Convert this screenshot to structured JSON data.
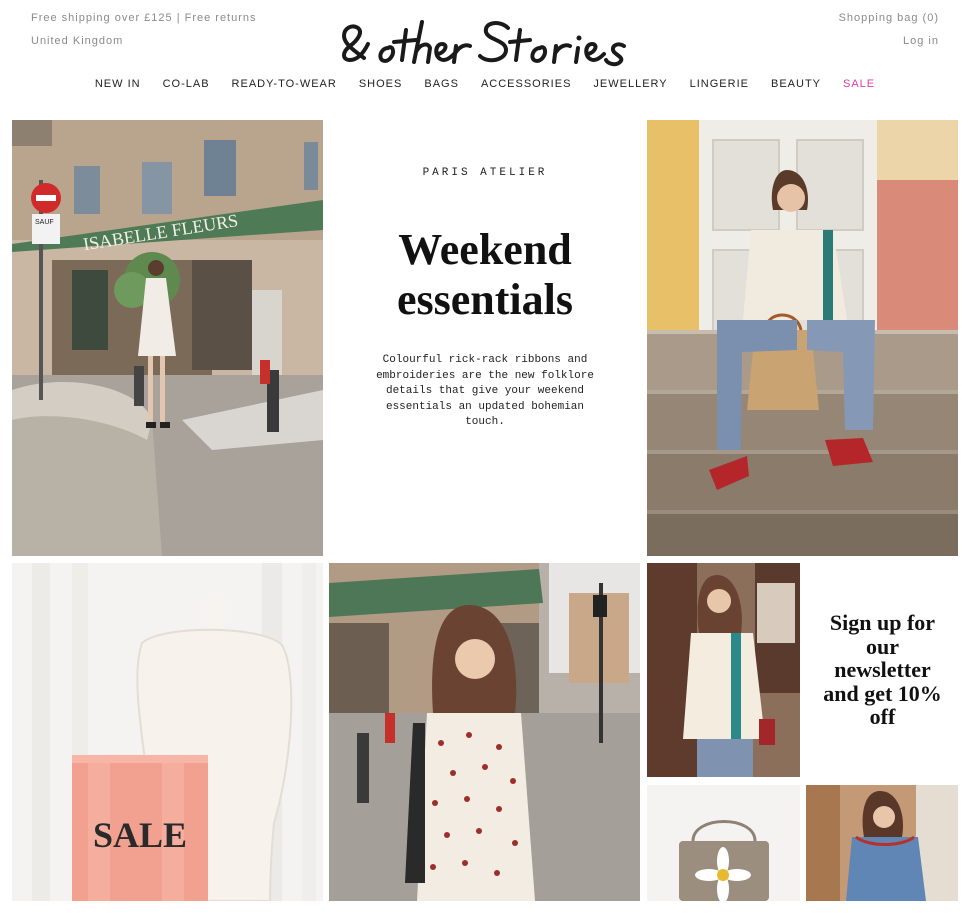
{
  "header": {
    "shipping_note": "Free shipping over £125 | Free returns",
    "region": "United Kingdom",
    "bag_label": "Shopping bag (0)",
    "login_label": "Log in",
    "logo_text": "& other Stories"
  },
  "nav": {
    "items": [
      {
        "label": "NEW IN"
      },
      {
        "label": "CO-LAB"
      },
      {
        "label": "READY-TO-WEAR"
      },
      {
        "label": "SHOES"
      },
      {
        "label": "BAGS"
      },
      {
        "label": "ACCESSORIES"
      },
      {
        "label": "JEWELLERY"
      },
      {
        "label": "LINGERIE"
      },
      {
        "label": "BEAUTY"
      },
      {
        "label": "SALE"
      }
    ],
    "sale_color": "#e23aa8"
  },
  "feature": {
    "kicker": "PARIS ATELIER",
    "headline_line1": "Weekend",
    "headline_line2": "essentials",
    "body": "Colourful rick-rack ribbons and embroideries are the new folklore details that give your weekend essentials an updated bohemian touch."
  },
  "photo_text": {
    "shop_sign": "ISABELLE FLEURS",
    "street_sign": "SAUF",
    "sale_sign": "SALE"
  },
  "newsletter": {
    "text": "Sign up for our newsletter and get 10% off"
  }
}
